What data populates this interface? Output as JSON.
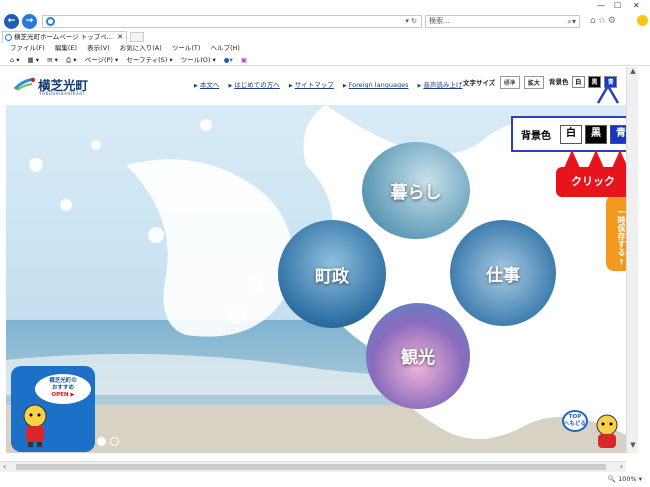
{
  "browser": {
    "search_placeholder": "検索...",
    "tab_title": "横芝光町ホームページ トップペ...",
    "menu": [
      "ファイル(F)",
      "編集(E)",
      "表示(V)",
      "お気に入り(A)",
      "ツール(T)",
      "ヘルプ(H)"
    ],
    "commands": [
      "ページ(P) ▾",
      "セーフティ(S) ▾",
      "ツール(O) ▾"
    ],
    "zoom": "🔍 100% ▾",
    "window_controls": [
      "—",
      "☐",
      "✕"
    ]
  },
  "site": {
    "logo_name": "横芝光町",
    "logo_sub": "YOKOSHIBAHIKARI",
    "nav": [
      "本文へ",
      "はじめての方へ",
      "サイトマップ",
      "Foreign languages",
      "音声読み上げ"
    ],
    "text_size_label": "文字サイズ",
    "text_size_standard": "標準",
    "text_size_large": "拡大",
    "bg_color_label": "背景色",
    "bg_white": "白",
    "bg_black": "黒",
    "bg_blue": "青"
  },
  "hero": {
    "circles": [
      "暮らし",
      "町政",
      "仕事",
      "観光"
    ],
    "side_tab": "一時保存する ←",
    "recommend_line1": "横芝光町の",
    "recommend_line2": "おすすめ",
    "recommend_open": "OPEN ▶",
    "top_button": "TOPへもどる"
  },
  "callout": {
    "label": "背景色",
    "white": "白",
    "black": "黒",
    "blue": "青",
    "click": "クリック"
  },
  "colors": {
    "brand_navy": "#123a70",
    "callout_border": "#2a3fbf",
    "click_red": "#e8141c",
    "bg_blue": "#1638c8",
    "side_orange": "#f39a1e"
  }
}
